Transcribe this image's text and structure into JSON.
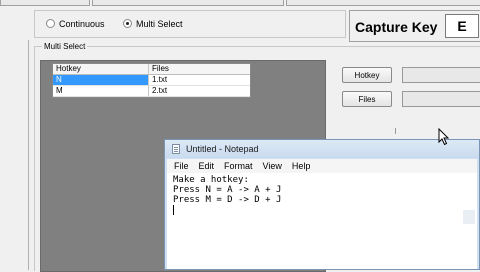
{
  "mode": {
    "continuous_label": "Continuous",
    "multi_label": "Multi Select",
    "selected": "Multi Select"
  },
  "capture": {
    "label": "Capture Key",
    "key": "E"
  },
  "multi_select": {
    "group_label": "Multi Select",
    "table": {
      "headers": [
        "Hotkey",
        "Files"
      ],
      "rows": [
        {
          "hotkey": "N",
          "file": "1.txt",
          "selected": true
        },
        {
          "hotkey": "M",
          "file": "2.txt",
          "selected": false
        }
      ]
    }
  },
  "controls": {
    "hotkey_button": "Hotkey",
    "files_button": "Files"
  },
  "notepad": {
    "title": "Untitled - Notepad",
    "menu": [
      "File",
      "Edit",
      "Format",
      "View",
      "Help"
    ],
    "lines": [
      "Make a hotkey:",
      "Press N = A -> A + J",
      "Press M = D -> D + J"
    ]
  },
  "icons": {
    "notepad_icon": "notepad-icon",
    "cursor": "mouse-pointer-icon"
  },
  "colors": {
    "selection": "#3399ff",
    "dark_panel": "#808080",
    "notepad_frame": "#cfe0f2"
  }
}
